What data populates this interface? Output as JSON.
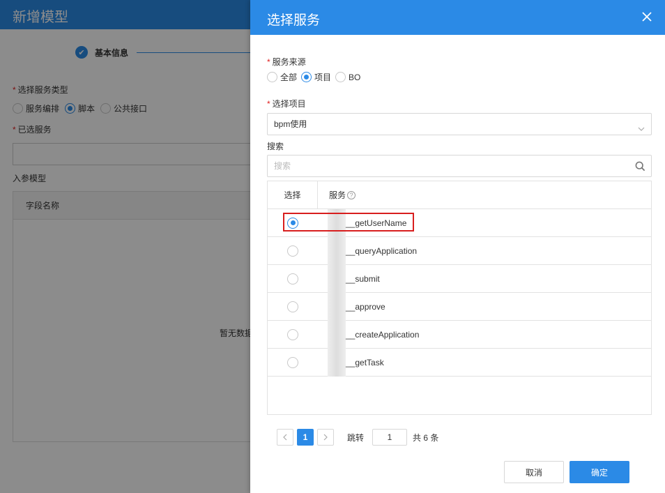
{
  "background": {
    "title": "新增模型",
    "step_icon": "check-icon",
    "step_label": "基本信息",
    "service_type_label": "选择服务类型",
    "service_type_options": [
      {
        "label": "服务编排",
        "selected": false
      },
      {
        "label": "脚本",
        "selected": true
      },
      {
        "label": "公共接口",
        "selected": false
      }
    ],
    "selected_service_label": "已选服务",
    "input_model_label": "入参模型",
    "table_col_field_name": "字段名称",
    "empty_text": "暂无数据"
  },
  "drawer": {
    "title": "选择服务",
    "close_icon": "close-icon",
    "source_label": "服务来源",
    "source_options": [
      {
        "label": "全部",
        "selected": false
      },
      {
        "label": "项目",
        "selected": true
      },
      {
        "label": "BO",
        "selected": false
      }
    ],
    "project_label": "选择项目",
    "project_value": "bpm使用",
    "search_label": "搜索",
    "search_placeholder": "搜索",
    "table": {
      "col_select": "选择",
      "col_service": "服务",
      "help_glyph": "?",
      "rows": [
        {
          "name": "__getUserName",
          "selected": true
        },
        {
          "name": "__queryApplication",
          "selected": false
        },
        {
          "name": "__submit",
          "selected": false
        },
        {
          "name": "__approve",
          "selected": false
        },
        {
          "name": "__createApplication",
          "selected": false
        },
        {
          "name": "__getTask",
          "selected": false
        }
      ]
    },
    "pagination": {
      "prev_glyph": "‹",
      "next_glyph": "›",
      "current_page": "1",
      "jump_label": "跳转",
      "jump_value": "1",
      "total_text": "共 6 条"
    },
    "cancel_label": "取消",
    "confirm_label": "确定"
  },
  "colors": {
    "primary": "#2b8ae6",
    "required": "#e02020",
    "highlight_box": "#d81e1e"
  }
}
